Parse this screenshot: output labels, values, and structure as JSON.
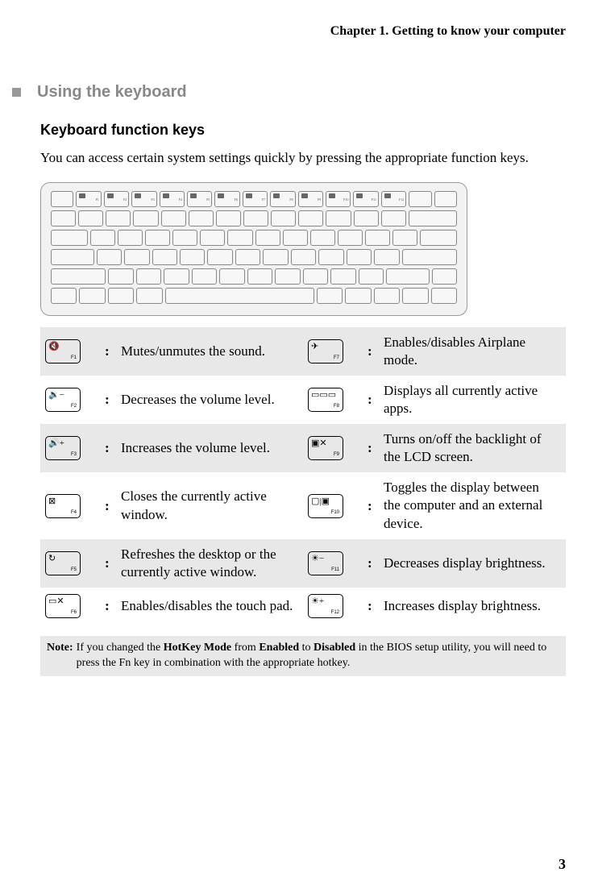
{
  "chapter_header": "Chapter 1. Getting to know your computer",
  "section_title": "Using the keyboard",
  "subsection_title": "Keyboard function keys",
  "intro_text": "You can access certain system settings quickly by pressing the appropriate function keys.",
  "function_keys": [
    {
      "left": {
        "glyph": "🔇",
        "label": "F1",
        "desc": "Mutes/unmutes the sound."
      },
      "right": {
        "glyph": "✈",
        "label": "F7",
        "desc": "Enables/disables Airplane mode."
      },
      "shaded": true
    },
    {
      "left": {
        "glyph": "🔉−",
        "label": "F2",
        "desc": "Decreases the volume level."
      },
      "right": {
        "glyph": "▭▭▭",
        "label": "F8",
        "desc": "Displays all currently active apps."
      },
      "shaded": false
    },
    {
      "left": {
        "glyph": "🔊+",
        "label": "F3",
        "desc": "Increases the volume level."
      },
      "right": {
        "glyph": "▣✕",
        "label": "F9",
        "desc": "Turns on/off the backlight of the LCD screen."
      },
      "shaded": true
    },
    {
      "left": {
        "glyph": "⊠",
        "label": "F4",
        "desc": "Closes the currently active window."
      },
      "right": {
        "glyph": "▢|▣",
        "label": "F10",
        "desc": "Toggles the display between the computer and an external device."
      },
      "shaded": false
    },
    {
      "left": {
        "glyph": "↻",
        "label": "F5",
        "desc": "Refreshes the desktop or the currently active window."
      },
      "right": {
        "glyph": "☀−",
        "label": "F11",
        "desc": "Decreases display brightness."
      },
      "shaded": true
    },
    {
      "left": {
        "glyph": "▭✕",
        "label": "F6",
        "desc": "Enables/disables the touch pad."
      },
      "right": {
        "glyph": "☀+",
        "label": "F12",
        "desc": "Increases display brightness."
      },
      "shaded": false
    }
  ],
  "note_label": "Note:",
  "note_text_parts": {
    "pre": "If you changed the ",
    "b1": "HotKey Mode",
    "mid1": " from ",
    "b2": "Enabled",
    "mid2": " to ",
    "b3": "Disabled",
    "post": " in the BIOS setup utility, you will need to press the Fn key in combination with the appropriate hotkey."
  },
  "page_number": "3"
}
